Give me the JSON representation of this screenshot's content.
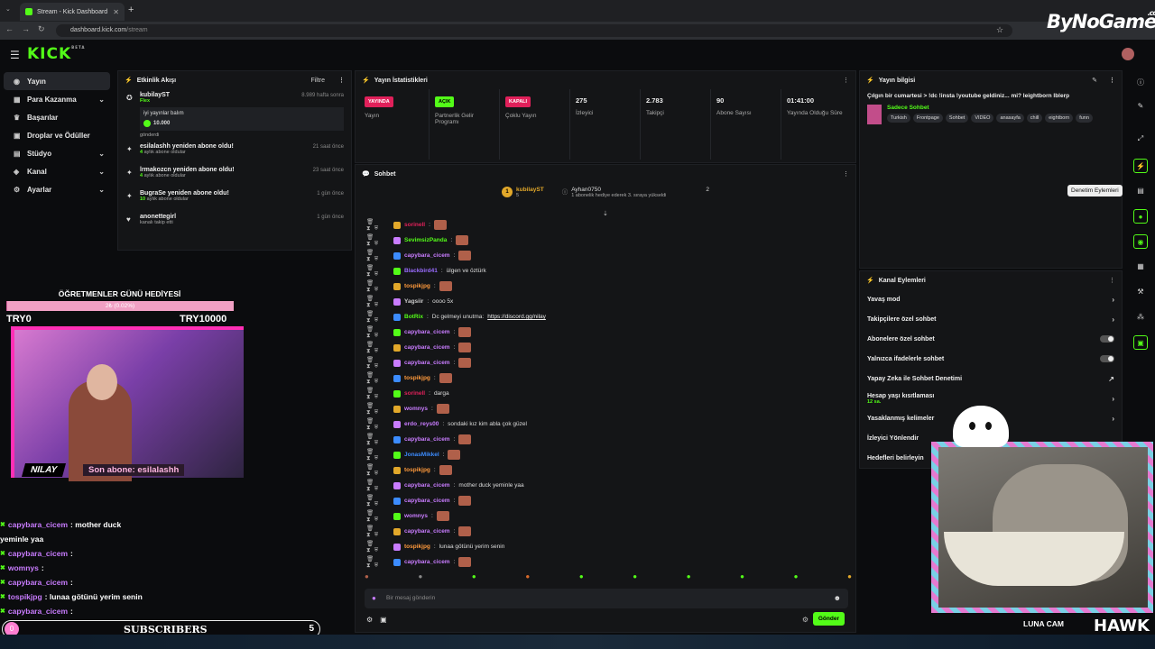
{
  "browser": {
    "tab_title": "Stream - Kick Dashboard",
    "url_host": "dashboard.kick.com",
    "url_path": "/stream"
  },
  "watermark": {
    "brand": "ByNoGame",
    "suffix": ".com"
  },
  "kick": {
    "logo": "KICK",
    "beta": "BETA"
  },
  "nav": [
    {
      "label": "Yayın",
      "icon": "stream-icon",
      "chevron": false
    },
    {
      "label": "Para Kazanma",
      "icon": "money-icon",
      "chevron": true
    },
    {
      "label": "Başarılar",
      "icon": "trophy-icon",
      "chevron": false
    },
    {
      "label": "Droplar ve Ödüller",
      "icon": "gift-icon",
      "chevron": false
    },
    {
      "label": "Stüdyo",
      "icon": "studio-icon",
      "chevron": true
    },
    {
      "label": "Kanal",
      "icon": "channel-icon",
      "chevron": true
    },
    {
      "label": "Ayarlar",
      "icon": "settings-icon",
      "chevron": true
    }
  ],
  "activity": {
    "title": "Etkinlik Akışı",
    "filter": "Filtre",
    "items": [
      {
        "name": "kubilayST",
        "time": "8.989 hafta sonra",
        "sub": "Flex",
        "gift_note": "iyi yayınlar balım",
        "gift_amount": "10.000",
        "footer": "gönderdi"
      },
      {
        "name": "esilalashh yeniden abone oldu!",
        "time": "21 saat önce",
        "months": "4",
        "sub": "aylık abone oldular"
      },
      {
        "name": "lrmakozcn yeniden abone oldu!",
        "time": "23 saat önce",
        "months": "4",
        "sub": "aylık abone oldular"
      },
      {
        "name": "BugraSe yeniden abone oldu!",
        "time": "1 gün önce",
        "months": "10",
        "sub": "aylık abone oldular"
      },
      {
        "name": "anonettegirl",
        "time": "1 gün önce",
        "months": "",
        "sub": "kanalı takip etti"
      }
    ]
  },
  "stats": {
    "title": "Yayın İstatistikleri",
    "items": [
      {
        "pill": "YAYINDA",
        "pill_color": "#e0205a",
        "value": "",
        "label": "Yayın"
      },
      {
        "pill": "AÇIK",
        "pill_color": "#53fc18",
        "value": "",
        "label": "Partnerlik Gelir Programı"
      },
      {
        "pill": "KAPALI",
        "pill_color": "#e0205a",
        "value": "",
        "label": "Çoklu Yayın"
      },
      {
        "pill": "",
        "pill_color": "",
        "value": "275",
        "label": "İzleyici"
      },
      {
        "pill": "",
        "pill_color": "",
        "value": "2.783",
        "label": "Takipçi"
      },
      {
        "pill": "",
        "pill_color": "",
        "value": "90",
        "label": "Abone Sayısı"
      },
      {
        "pill": "",
        "pill_color": "",
        "value": "01:41:00",
        "label": "Yayında Olduğu Süre"
      }
    ]
  },
  "chat": {
    "title": "Sohbet",
    "leader1_name": "kubilayST",
    "leader1_count": "5",
    "leader2_name": "Ayhan0750",
    "leader2_count": "2",
    "leader2_note": "1 abonelik hediye ederek 3. sıraya yükseldi",
    "input_placeholder": "Bir mesaj gönderin",
    "send": "Gönder",
    "messages": [
      {
        "user": "sorinell",
        "color": "#e0205a",
        "text": "",
        "emote": true,
        "link": ""
      },
      {
        "user": "SevimsizPanda",
        "color": "#53fc18",
        "text": "",
        "emote": true,
        "link": ""
      },
      {
        "user": "capybara_cicem",
        "color": "#c97cff",
        "text": "",
        "emote": true,
        "link": ""
      },
      {
        "user": "Blackbird41",
        "color": "#9a6cff",
        "text": "ülgen ve öztürk",
        "emote": false,
        "link": ""
      },
      {
        "user": "tospikjpg",
        "color": "#ff9a3c",
        "text": "",
        "emote": true,
        "link": ""
      },
      {
        "user": "Yagsiir",
        "color": "#cccccc",
        "text": "oooo 5x",
        "emote": false,
        "link": ""
      },
      {
        "user": "BotRix",
        "color": "#53fc18",
        "text": "Dc gelmeyi unutma: ",
        "emote": false,
        "link": "https://discord.gg/nilay"
      },
      {
        "user": "capybara_cicem",
        "color": "#c97cff",
        "text": "",
        "emote": true,
        "link": ""
      },
      {
        "user": "capybara_cicem",
        "color": "#c97cff",
        "text": "",
        "emote": true,
        "link": ""
      },
      {
        "user": "capybara_cicem",
        "color": "#c97cff",
        "text": "",
        "emote": true,
        "link": ""
      },
      {
        "user": "tospikjpg",
        "color": "#ff9a3c",
        "text": "",
        "emote": true,
        "link": ""
      },
      {
        "user": "sorinell",
        "color": "#e0205a",
        "text": "darga",
        "emote": false,
        "link": ""
      },
      {
        "user": "womnys",
        "color": "#c97cff",
        "text": "",
        "emote": true,
        "link": ""
      },
      {
        "user": "erdo_reys00",
        "color": "#c97cff",
        "text": "sondaki kız kim abla çok güzel",
        "emote": false,
        "link": ""
      },
      {
        "user": "capybara_cicem",
        "color": "#c97cff",
        "text": "",
        "emote": true,
        "link": ""
      },
      {
        "user": "JonasMikkel",
        "color": "#3c8cff",
        "text": "",
        "emote": true,
        "link": ""
      },
      {
        "user": "tospikjpg",
        "color": "#ff9a3c",
        "text": "",
        "emote": true,
        "link": ""
      },
      {
        "user": "capybara_cicem",
        "color": "#c97cff",
        "text": "mother duck yeminle yaa",
        "emote": false,
        "link": ""
      },
      {
        "user": "capybara_cicem",
        "color": "#c97cff",
        "text": "",
        "emote": true,
        "link": ""
      },
      {
        "user": "womnys",
        "color": "#c97cff",
        "text": "",
        "emote": true,
        "link": ""
      },
      {
        "user": "capybara_cicem",
        "color": "#c97cff",
        "text": "",
        "emote": true,
        "link": ""
      },
      {
        "user": "tospikjpg",
        "color": "#ff9a3c",
        "text": "lunaa götünü yerim senin",
        "emote": false,
        "link": ""
      },
      {
        "user": "capybara_cicem",
        "color": "#c97cff",
        "text": "",
        "emote": true,
        "link": ""
      }
    ]
  },
  "info": {
    "title": "Yayın bilgisi",
    "stream_title": "Çılgın bir cumartesi > !dc !insta !youtube geldiniz... mi? leightborn lblerp",
    "category": "Sadece Sohbet",
    "tags": [
      "Turkish",
      "Frontpage",
      "Sohbet",
      "VIDEO",
      "anasayfa",
      "chill",
      "eightborn",
      "funn"
    ]
  },
  "actions": {
    "title": "Kanal Eylemleri",
    "items": [
      {
        "label": "Yavaş mod",
        "kind": "chevron",
        "note": ""
      },
      {
        "label": "Takipçilere özel sohbet",
        "kind": "chevron",
        "note": ""
      },
      {
        "label": "Abonelere özel sohbet",
        "kind": "toggle",
        "note": ""
      },
      {
        "label": "Yalnızca ifadelerle sohbet",
        "kind": "toggle",
        "note": ""
      },
      {
        "label": "Yapay Zeka ile Sohbet Denetimi",
        "kind": "external",
        "note": ""
      },
      {
        "label": "Hesap yaşı kısıtlaması",
        "kind": "chevron",
        "note": "12 sa."
      },
      {
        "label": "Yasaklanmış kelimeler",
        "kind": "chevron",
        "note": ""
      },
      {
        "label": "İzleyici Yönlendir",
        "kind": "none",
        "note": ""
      },
      {
        "label": "Hedefleri belirleyin",
        "kind": "none",
        "note": ""
      }
    ]
  },
  "tooltip": "Denetim Eylemleri",
  "overlay": {
    "goal_title": "ÖĞRETMENLER GÜNÜ HEDİYESİ",
    "goal_text": "2₺ (0.02%)",
    "goal_progress": 0.0002,
    "goal_min": "TRY0",
    "goal_max": "TRY10000",
    "streamer": "NILAY",
    "last_sub": "Son abone: esilalashh",
    "chat": [
      {
        "user": "capybara_cicem",
        "text": ": mother duck"
      },
      {
        "user": "",
        "text": "yeminle yaa"
      },
      {
        "user": "capybara_cicem",
        "text": ":"
      },
      {
        "user": "womnys",
        "text": ":"
      },
      {
        "user": "capybara_cicem",
        "text": ":"
      },
      {
        "user": "tospikjpg",
        "text": ": lunaa götünü yerim senin"
      },
      {
        "user": "capybara_cicem",
        "text": ":"
      }
    ],
    "sub_count_left": "0",
    "subscribers": "SUBSCRIBERS",
    "sub_count_right": "5",
    "cat_label": "LUNA CAM",
    "hawk": "HAWK"
  }
}
